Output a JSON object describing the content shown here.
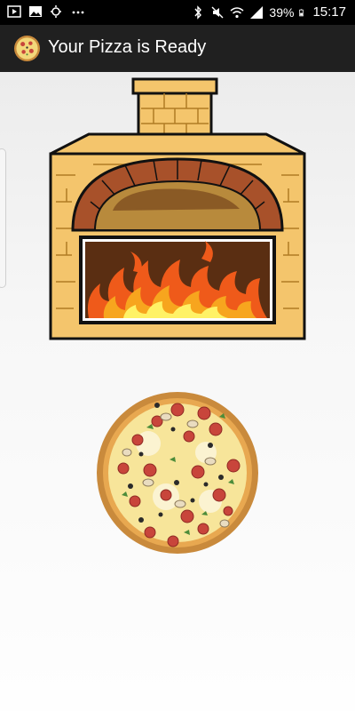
{
  "status_bar": {
    "time": "15:17",
    "battery_percent": "39%",
    "left_icons": [
      "play-icon",
      "image-icon",
      "weather-icon",
      "more-icon"
    ],
    "right_icons": [
      "bluetooth-icon",
      "mute-icon",
      "wifi-icon",
      "signal-icon",
      "battery-icon"
    ]
  },
  "app_bar": {
    "title": "Your Pizza is Ready",
    "icon": "pizza-app-icon",
    "background": "#202020"
  },
  "content": {
    "images": [
      "brick-oven-illustration",
      "pizza-illustration"
    ]
  }
}
